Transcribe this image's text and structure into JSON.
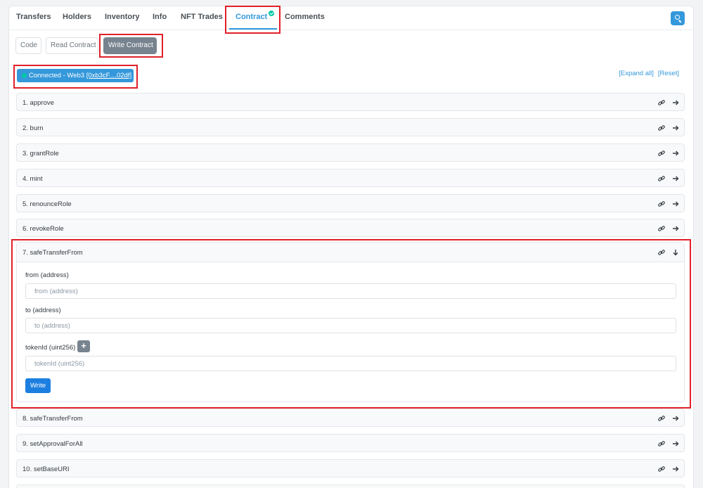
{
  "tabs": [
    {
      "label": "Transfers"
    },
    {
      "label": "Holders"
    },
    {
      "label": "Inventory"
    },
    {
      "label": "Info"
    },
    {
      "label": "NFT Trades"
    },
    {
      "label": "Contract"
    },
    {
      "label": "Comments"
    }
  ],
  "active_tab": "Contract",
  "subtabs": [
    {
      "label": "Code"
    },
    {
      "label": "Read Contract"
    },
    {
      "label": "Write Contract"
    }
  ],
  "active_subtab": "Write Contract",
  "connection": {
    "status": "Connected - Web3",
    "address": "[0xb3cF....02df]"
  },
  "controls": {
    "expand_all": "[Expand all]",
    "reset": "[Reset]"
  },
  "functions": [
    {
      "label": "1. approve"
    },
    {
      "label": "2. burn"
    },
    {
      "label": "3. grantRole"
    },
    {
      "label": "4. mint"
    },
    {
      "label": "5. renounceRole"
    },
    {
      "label": "6. revokeRole"
    },
    {
      "label": "7. safeTransferFrom"
    },
    {
      "label": "8. safeTransferFrom"
    },
    {
      "label": "9. setApprovalForAll"
    },
    {
      "label": "10. setBaseURI"
    }
  ],
  "expanded_function": {
    "fields": [
      {
        "label": "from (address)",
        "placeholder": "from (address)"
      },
      {
        "label": "to (address)",
        "placeholder": "to (address)"
      },
      {
        "label": "tokenId (uint256)",
        "placeholder": "tokenId (uint256)"
      }
    ],
    "add_button": "+",
    "write_button": "Write"
  },
  "colors": {
    "accent": "#3498db",
    "success": "#00c9a7",
    "highlight": "#e0202a",
    "write_button": "#1c7fe0"
  }
}
